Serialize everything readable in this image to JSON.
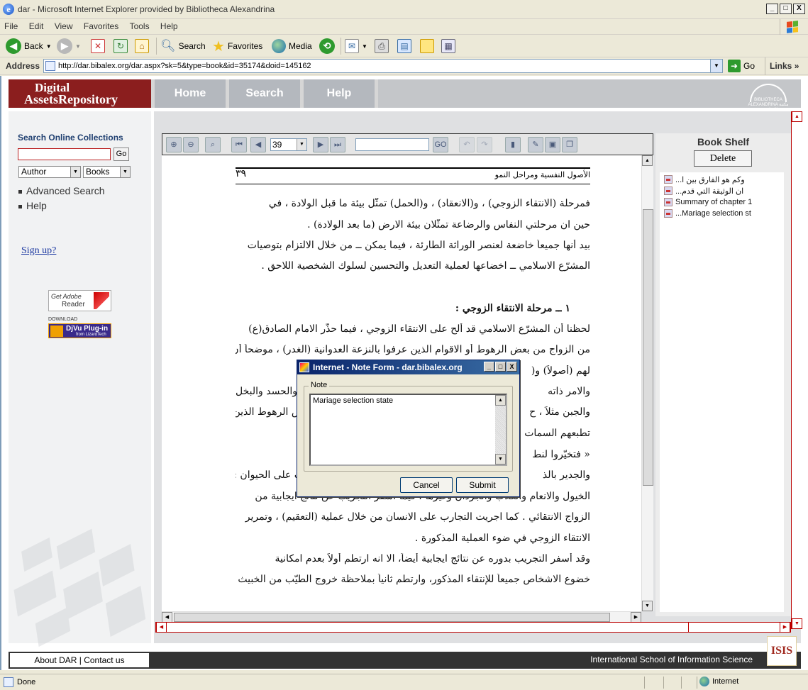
{
  "window": {
    "title": "dar - Microsoft Internet Explorer provided by Bibliotheca Alexandrina",
    "buttons": {
      "minimize": "_",
      "maximize": "□",
      "close": "X"
    }
  },
  "menu": [
    "File",
    "Edit",
    "View",
    "Favorites",
    "Tools",
    "Help"
  ],
  "toolbar": {
    "back": "Back",
    "search": "Search",
    "favorites": "Favorites",
    "media": "Media"
  },
  "address": {
    "label": "Address",
    "url": "http://dar.bibalex.org/dar.aspx?sk=5&type=book&id=35174&doid=145162",
    "go": "Go",
    "links": "Links"
  },
  "site": {
    "logo_line1": "Digital",
    "logo_line2": "AssetsRepository",
    "nav": [
      "Home",
      "Search",
      "Help"
    ],
    "partner_logo_text": "BIBLIOTHECA ALEXANDRINA مكتبة الإسكندرية"
  },
  "left_panel": {
    "title": "Search Online Collections",
    "search_value": "",
    "go": "Go",
    "field_select": "Author",
    "type_select": "Books",
    "advanced": "Advanced Search",
    "help": "Help",
    "signup": "Sign up?",
    "adobe_get": "Get Adobe",
    "adobe_reader": "Reader",
    "djvu_download": "DOWNLOAD",
    "djvu_title": "DjVu Plug-in",
    "djvu_sub": "from LizardTech"
  },
  "viewer": {
    "page_number": "39",
    "search_value": "",
    "buttons": [
      "zoom-in",
      "zoom-out",
      "zoom-fit",
      "first-page",
      "prev-page",
      "next-page",
      "last-page",
      "search-go",
      "undo",
      "redo",
      "bookmark",
      "note",
      "save",
      "copy"
    ]
  },
  "document": {
    "page_num": "٣٩",
    "running_head": "الأصول النفسية ومراحل النمو",
    "lines": [
      "فمرحلة (الانتقاء الزوجي) ، و(الانعقاد) ، و(الحمل) تمثّل بيئة ما قبل الولادة ، في",
      "حين ان مرحلتي النفاس والرضاعة تمثّلان بيئة الارض (ما بعد الولادة) .",
      "بيد أنها جميعاً خاضعة لعنصر الوراثة الطارئة ، فيما يمكن ــ من خلال الالتزام بتوصيات",
      "المشرّع الاسلامي ــ اخضاعها لعملية التعديل والتحسين لسلوك الشخصية اللاحق .",
      "١ ــ مرحلة الانتقاء الزوجي :",
      "لحظنا أن المشرّع الاسلامي قد ألح على الانتقاء الزوجي ، فيما حذّر الامام الصادق(ع)",
      "من الزواج من بعض الرهوط أو الاقوام الذين عرفوا بالنزعة العدوانية (الغدر) ، موضحاً أن",
      "لهم (أصولاً) و(",
      "والامر ذاته",
      "والجبن مثلاً ، ح",
      "تطبعهم السمات",
      "« فتخيّروا لنط",
      "والجدير بالذ",
      "الخيول والانعام والكلاب والجرذان وغيرها ، فيما أسفر التجريب عن نتائج ايجابية من",
      "الزواج الانتقائي . كما اجريت التجارب على الانسان من خلال عملية (التعقيم) ، وتمرير",
      "الانتقاء الزوجي في ضوء العملية المذكورة .",
      "وقد أسفر التجريب بدوره عن نتائج ايجابية أيضاً، الا انه ارتطم أولاً بعدم امكانية",
      "خضوع الاشخاص جميعاً للإنتقاء المذكور، وارتطم ثانياً بملاحظة خروج الطيّب من الخبيث"
    ],
    "line_right_fragments": [
      "والحسد والبخل",
      "س الرهوط الذين",
      "ب على الحيوان :"
    ]
  },
  "bookshelf": {
    "title": "Book Shelf",
    "delete": "Delete",
    "items": [
      "وكم هو الفارق بين ا...",
      "ان الوثيقة التي قدم...",
      "Summary of chapter 1",
      "...Mariage selection st"
    ]
  },
  "dialog": {
    "title": "Internet - Note Form - dar.bibalex.org",
    "group_label": "Note",
    "note_text": "Mariage selection state",
    "cancel": "Cancel",
    "submit": "Submit"
  },
  "footer": {
    "left": "About DAR | Contact us",
    "right": "International School of Information Science",
    "logo": "ISIS"
  },
  "status": {
    "text": "Done",
    "zone": "Internet"
  }
}
